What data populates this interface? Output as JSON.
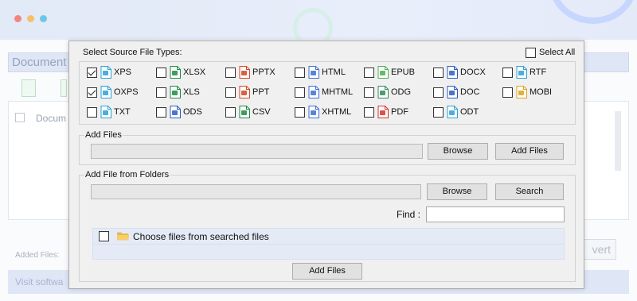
{
  "background": {
    "header_title": "Document",
    "list_item": "Docum",
    "added_files_label": "Added Files:",
    "convert_button": "vert",
    "footer_text": "Visit softwa"
  },
  "dialog": {
    "source_types_label": "Select Source File Types:",
    "select_all_label": "Select All",
    "file_types": [
      {
        "label": "XPS",
        "checked": true,
        "icon": "xps-file-icon",
        "color": "#2aa0d8"
      },
      {
        "label": "XLSX",
        "checked": false,
        "icon": "excel-file-icon",
        "color": "#1e8a44"
      },
      {
        "label": "PPTX",
        "checked": false,
        "icon": "powerpoint-file-icon",
        "color": "#d24726"
      },
      {
        "label": "HTML",
        "checked": false,
        "icon": "html-file-icon",
        "color": "#3b6fd6"
      },
      {
        "label": "EPUB",
        "checked": false,
        "icon": "epub-file-icon",
        "color": "#4caf50"
      },
      {
        "label": "DOCX",
        "checked": false,
        "icon": "word-file-icon",
        "color": "#2b5cc4"
      },
      {
        "label": "RTF",
        "checked": false,
        "icon": "rtf-file-icon",
        "color": "#2aa0d8"
      },
      {
        "label": "OXPS",
        "checked": true,
        "icon": "oxps-file-icon",
        "color": "#2aa0d8"
      },
      {
        "label": "XLS",
        "checked": false,
        "icon": "excel-file-icon",
        "color": "#1e8a44"
      },
      {
        "label": "PPT",
        "checked": false,
        "icon": "powerpoint-file-icon",
        "color": "#d24726"
      },
      {
        "label": "MHTML",
        "checked": false,
        "icon": "mhtml-file-icon",
        "color": "#3b6fd6"
      },
      {
        "label": "ODG",
        "checked": false,
        "icon": "odg-file-icon",
        "color": "#2e8b57"
      },
      {
        "label": "DOC",
        "checked": false,
        "icon": "word-file-icon",
        "color": "#2b5cc4"
      },
      {
        "label": "MOBI",
        "checked": false,
        "icon": "mobi-file-icon",
        "color": "#e0a020"
      },
      {
        "label": "TXT",
        "checked": false,
        "icon": "text-file-icon",
        "color": "#2aa0d8"
      },
      {
        "label": "ODS",
        "checked": false,
        "icon": "ods-file-icon",
        "color": "#2b5cc4"
      },
      {
        "label": "CSV",
        "checked": false,
        "icon": "csv-file-icon",
        "color": "#1e8a44"
      },
      {
        "label": "XHTML",
        "checked": false,
        "icon": "xhtml-file-icon",
        "color": "#3b6fd6"
      },
      {
        "label": "PDF",
        "checked": false,
        "icon": "pdf-file-icon",
        "color": "#d9302c"
      },
      {
        "label": "ODT",
        "checked": false,
        "icon": "odt-file-icon",
        "color": "#2aa0d8"
      }
    ],
    "add_files_group": {
      "title": "Add Files",
      "path_value": "",
      "browse_label": "Browse",
      "add_files_label": "Add Files"
    },
    "folders_group": {
      "title": "Add File from Folders",
      "path_value": "",
      "browse_label": "Browse",
      "search_label": "Search",
      "find_label": "Find :",
      "find_value": "",
      "choose_label": "Choose files from searched files",
      "add_files_label": "Add Files"
    }
  }
}
